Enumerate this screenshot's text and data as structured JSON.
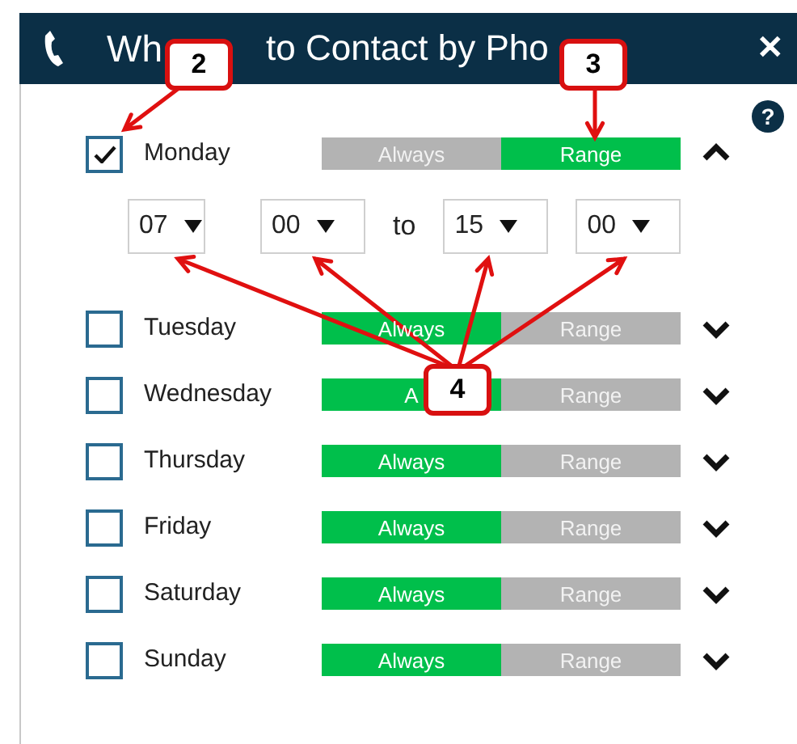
{
  "window": {
    "title_parts": [
      "Wh",
      "to Contact by Pho"
    ],
    "close": "✕"
  },
  "help": "?",
  "days": [
    {
      "name": "Monday",
      "checked": true,
      "expanded": true,
      "options": [
        {
          "label": "Always",
          "selected": false
        },
        {
          "label": "Range",
          "selected": true
        }
      ],
      "range": {
        "from_hour": "07",
        "from_minute": "00",
        "separator": "to",
        "to_hour": "15",
        "to_minute": "00"
      }
    },
    {
      "name": "Tuesday",
      "checked": false,
      "expanded": false,
      "options": [
        {
          "label": "Always",
          "selected": true
        },
        {
          "label": "Range",
          "selected": false
        }
      ]
    },
    {
      "name": "Wednesday",
      "checked": false,
      "expanded": false,
      "options": [
        {
          "label": "A",
          "selected": true
        },
        {
          "label": "Range",
          "selected": false
        }
      ]
    },
    {
      "name": "Thursday",
      "checked": false,
      "expanded": false,
      "options": [
        {
          "label": "Always",
          "selected": true
        },
        {
          "label": "Range",
          "selected": false
        }
      ]
    },
    {
      "name": "Friday",
      "checked": false,
      "expanded": false,
      "options": [
        {
          "label": "Always",
          "selected": true
        },
        {
          "label": "Range",
          "selected": false
        }
      ]
    },
    {
      "name": "Saturday",
      "checked": false,
      "expanded": false,
      "options": [
        {
          "label": "Always",
          "selected": true
        },
        {
          "label": "Range",
          "selected": false
        }
      ]
    },
    {
      "name": "Sunday",
      "checked": false,
      "expanded": false,
      "options": [
        {
          "label": "Always",
          "selected": true
        },
        {
          "label": "Range",
          "selected": false
        }
      ]
    }
  ],
  "callouts": [
    "2",
    "3",
    "4"
  ]
}
